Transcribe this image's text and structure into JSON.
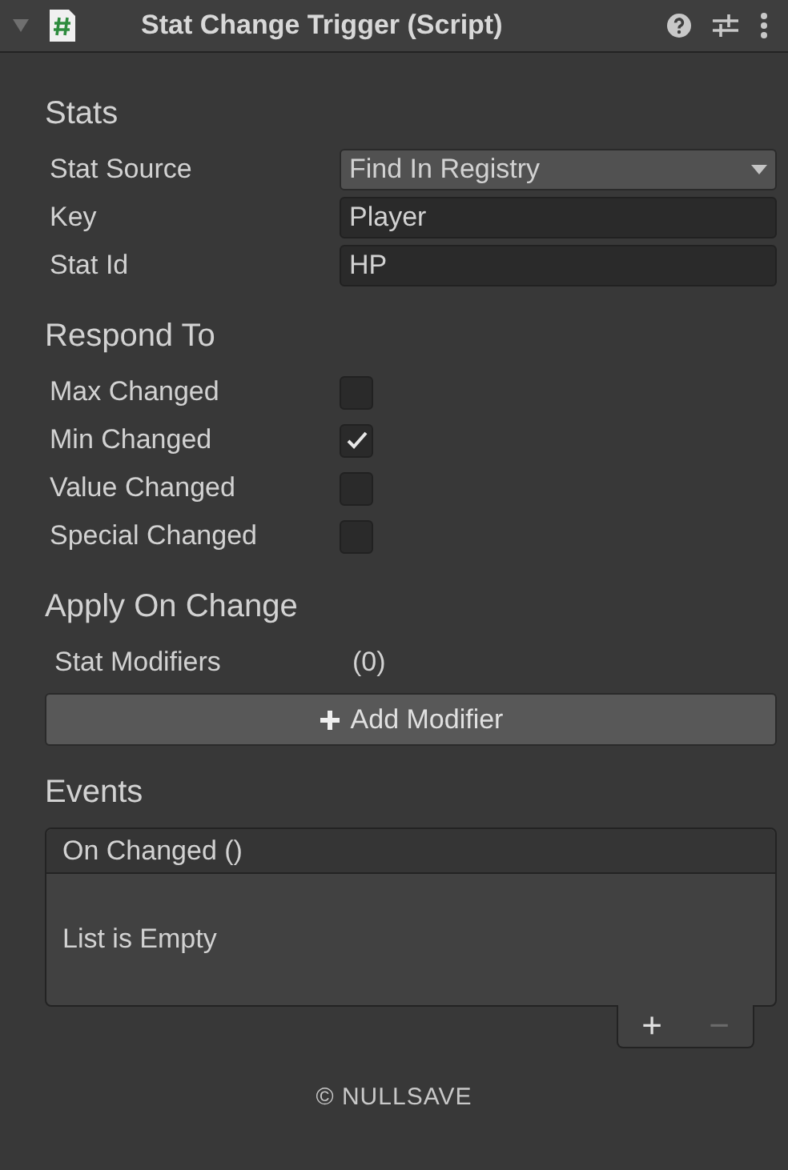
{
  "component": {
    "title": "Stat Change Trigger (Script)",
    "expanded": true
  },
  "sections": [
    {
      "title": "Stats",
      "fields": [
        {
          "kind": "dropdown",
          "label": "Stat Source",
          "value": "Find In Registry"
        },
        {
          "kind": "text",
          "label": "Key",
          "value": "Player"
        },
        {
          "kind": "text",
          "label": "Stat Id",
          "value": "HP"
        }
      ]
    },
    {
      "title": "Respond To",
      "fields": [
        {
          "kind": "checkbox",
          "label": "Max Changed",
          "checked": false
        },
        {
          "kind": "checkbox",
          "label": "Min Changed",
          "checked": true
        },
        {
          "kind": "checkbox",
          "label": "Value Changed",
          "checked": false
        },
        {
          "kind": "checkbox",
          "label": "Special Changed",
          "checked": false
        }
      ]
    },
    {
      "title": "Apply On Change",
      "fields": [
        {
          "kind": "list",
          "label": "Stat Modifiers",
          "count": "(0)",
          "button": "Add Modifier"
        }
      ]
    },
    {
      "title": "Events",
      "fields": [
        {
          "kind": "event",
          "label": "On Changed ()",
          "empty_text": "List is Empty",
          "add": "+",
          "remove": "−",
          "remove_disabled": true
        }
      ]
    }
  ],
  "footer": "© NULLSAVE"
}
